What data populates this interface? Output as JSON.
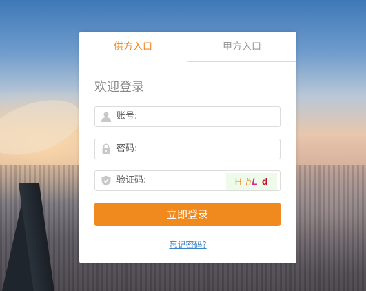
{
  "tabs": {
    "supplier_label": "供方入口",
    "buyer_label": "甲方入口"
  },
  "login": {
    "heading": "欢迎登录",
    "account_label": "账号:",
    "password_label": "密码:",
    "captcha_label": "验证码:",
    "account_value": "",
    "password_value": "",
    "captcha_value": "",
    "captcha_chars": [
      "H",
      "h",
      "L",
      "d"
    ],
    "submit_label": "立即登录",
    "forgot_label": "忘记密码?"
  },
  "icons": {
    "account": "user-icon",
    "password": "lock-icon",
    "captcha": "shield-icon"
  },
  "colors": {
    "accent": "#f0891e",
    "active_tab": "#f0892a",
    "link": "#3a86c8"
  }
}
